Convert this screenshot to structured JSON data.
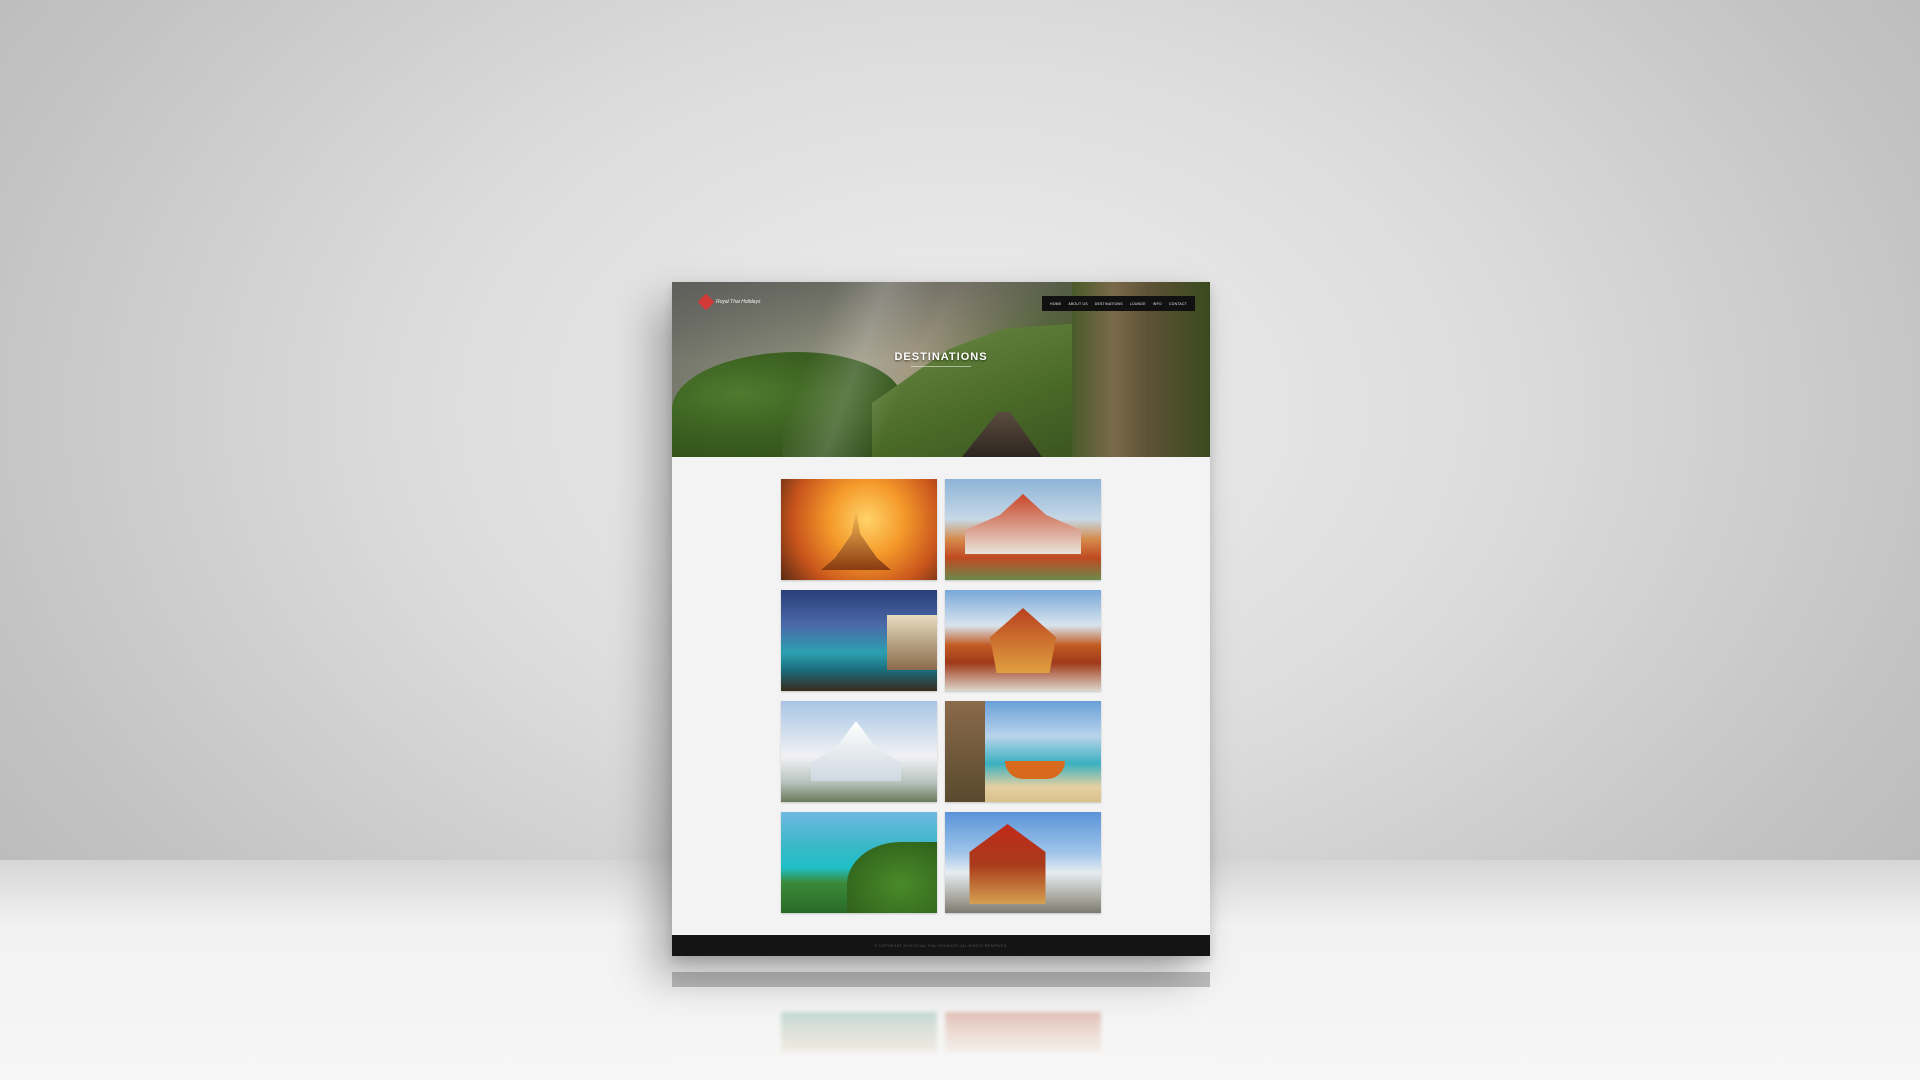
{
  "logo": {
    "text": "Royal Thai Holidays"
  },
  "nav": {
    "items": [
      {
        "label": "HOME"
      },
      {
        "label": "ABOUT US"
      },
      {
        "label": "DESTINATIONS"
      },
      {
        "label": "LOUNGE"
      },
      {
        "label": "INFO"
      },
      {
        "label": "CONTACT"
      }
    ]
  },
  "hero": {
    "title": "DESTINATIONS"
  },
  "destinations": [
    {
      "name": "temple-sunset-photo"
    },
    {
      "name": "marble-temple-photo"
    },
    {
      "name": "pool-villa-photo"
    },
    {
      "name": "golden-temple-photo"
    },
    {
      "name": "white-temple-photo"
    },
    {
      "name": "longtail-boat-beach-photo"
    },
    {
      "name": "tropical-bay-photo"
    },
    {
      "name": "royal-pavilion-photo"
    }
  ],
  "footer": {
    "text": "© COPYRIGHT 2019 ROYAL THAI HOLIDAYS. ALL RIGHTS RESERVED."
  },
  "colors": {
    "accent": "#d23a3a",
    "nav_bg": "#111111",
    "footer_bg": "#141414"
  }
}
